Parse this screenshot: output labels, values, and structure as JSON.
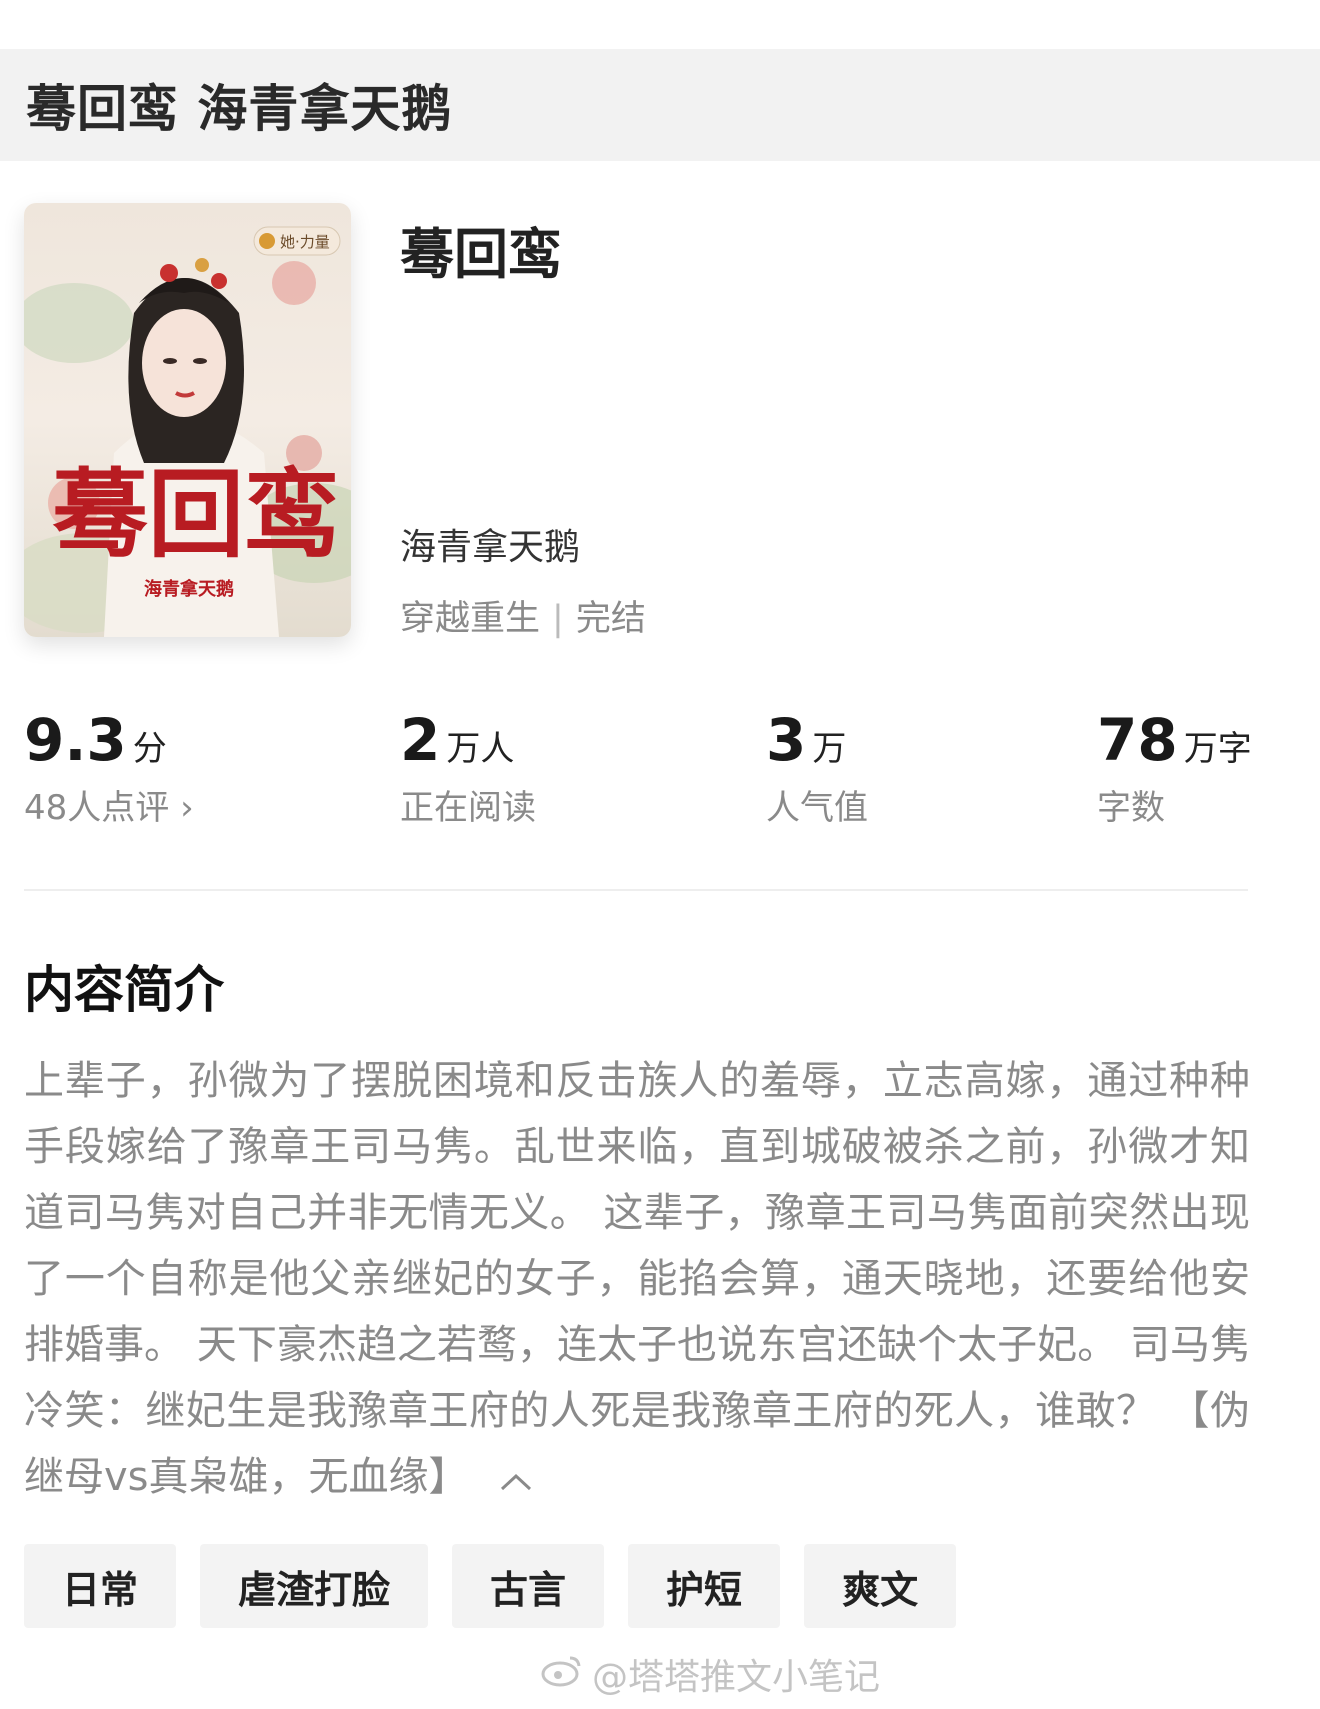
{
  "header": {
    "title": "蓦回鸾 海青拿天鹅"
  },
  "book": {
    "title": "蓦回鸾",
    "author": "海青拿天鹅",
    "category": "穿越重生",
    "status": "完结",
    "cover": {
      "badge": "她·力量",
      "title_art": "蓦回鸾",
      "author_art": "海青拿天鹅"
    }
  },
  "stats": [
    {
      "value": "9.3",
      "unit": "分",
      "label": "48人点评 ›"
    },
    {
      "value": "2",
      "unit": "万人",
      "label": "正在阅读"
    },
    {
      "value": "3",
      "unit": "万",
      "label": "人气值"
    },
    {
      "value": "78",
      "unit": "万字",
      "label": "字数"
    }
  ],
  "intro": {
    "heading": "内容简介",
    "text": "上辈子，孙微为了摆脱困境和反击族人的羞辱，立志高嫁，通过种种手段嫁给了豫章王司马隽。乱世来临，直到城破被杀之前，孙微才知道司马隽对自己并非无情无义。 这辈子，豫章王司马隽面前突然出现了一个自称是他父亲继妃的女子，能掐会算，通天晓地，还要给他安排婚事。 天下豪杰趋之若鹜，连太子也说东宫还缺个太子妃。 司马隽冷笑：继妃生是我豫章王府的人死是我豫章王府的死人，谁敢？ 【伪继母vs真枭雄，无血缘】"
  },
  "tags": [
    "日常",
    "虐渣打脸",
    "古言",
    "护短",
    "爽文"
  ],
  "watermark": "@塔塔推文小笔记",
  "colors": {
    "muted": "#8a8a8a",
    "tag_bg": "#f3f3f3",
    "header_bg": "#f2f2f2",
    "cover_red": "#b81c22"
  }
}
